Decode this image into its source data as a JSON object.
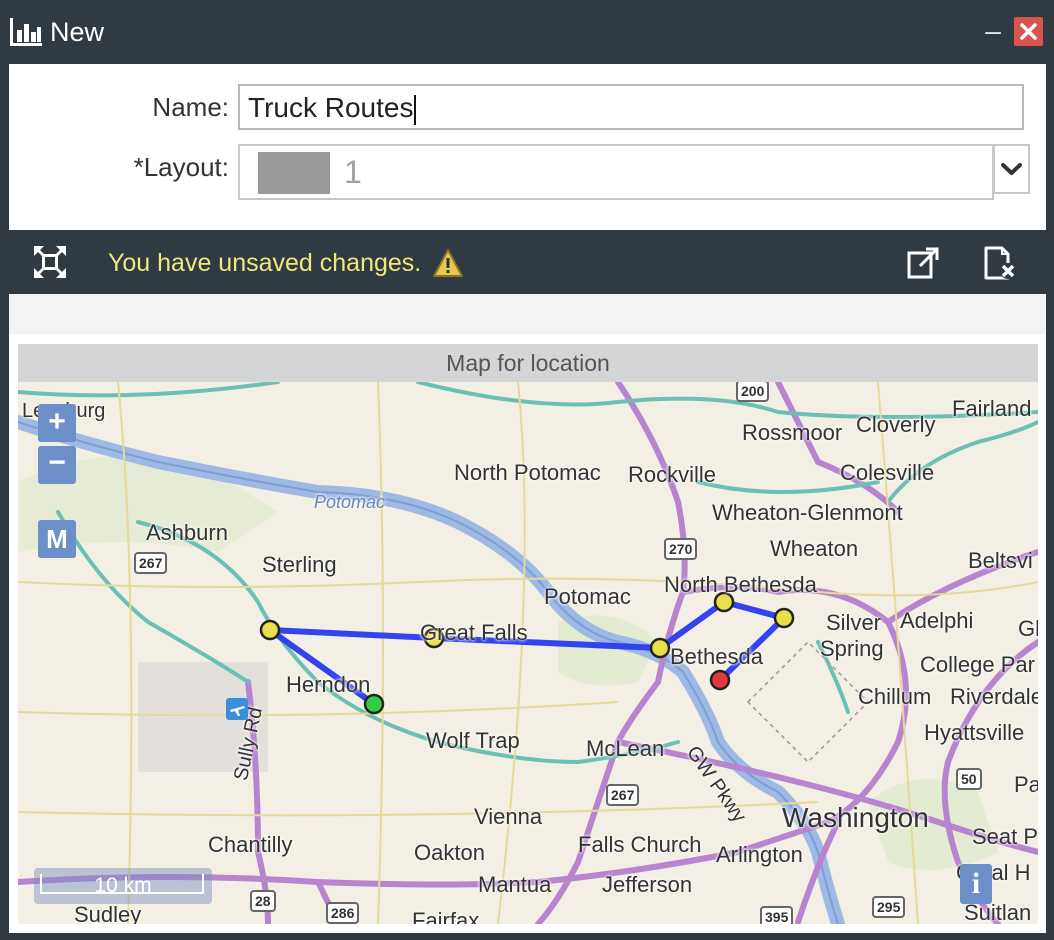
{
  "window": {
    "title": "New"
  },
  "form": {
    "name_label": "Name:",
    "name_value": "Truck Routes",
    "layout_label": "*Layout:",
    "layout_value": "1"
  },
  "toolbar": {
    "unsaved_message": "You have unsaved changes."
  },
  "map": {
    "header": "Map for location",
    "zoom_in": "+",
    "zoom_out": "−",
    "mode_button": "M",
    "info_button": "i",
    "scale": "10 km",
    "labels": {
      "leesburg": "Leesburg",
      "fairland": "Fairland",
      "rossmoor": "Rossmoor",
      "cloverly": "Cloverly",
      "north_potomac": "North Potomac",
      "rockville": "Rockville",
      "colesville": "Colesville",
      "potomac_river": "Potomac",
      "wheaton_glenmont": "Wheaton-Glenmont",
      "ashburn": "Ashburn",
      "wheaton": "Wheaton",
      "beltsville": "Beltsvi",
      "sterling": "Sterling",
      "north_bethesda": "North Bethesda",
      "potomac": "Potomac",
      "silver_spring_1": "Silver",
      "silver_spring_2": "Spring",
      "adelphi": "Adelphi",
      "great_falls": "Great Falls",
      "bethesda": "Bethesda",
      "college_park": "College Par",
      "herndon": "Herndon",
      "chillum": "Chillum",
      "riverdale": "Riverdale",
      "wolf_trap": "Wolf Trap",
      "mclean": "McLean",
      "hyattsville": "Hyattsville",
      "sully_rd": "Sully Rd",
      "gw_pkwy": "GW Pkwy",
      "vienna": "Vienna",
      "washington": "Washington",
      "seat_pleasant": "Seat P",
      "chantilly": "Chantilly",
      "falls_church": "Falls Church",
      "arlington": "Arlington",
      "oakton": "Oakton",
      "coral_hills": "Coral H",
      "mantua": "Mantua",
      "jefferson": "Jefferson",
      "sudley": "Sudley",
      "fairfax": "Fairfax",
      "suitland": "Suitlan",
      "gl": "Gl",
      "pa": "Pa"
    },
    "shields": {
      "r200": "200",
      "r270": "270",
      "r267a": "267",
      "r267b": "267",
      "r50": "50",
      "r28": "28",
      "r286": "286",
      "r295": "295",
      "r395": "395"
    },
    "colors": {
      "route": "#3344ee",
      "stop": "#e8e04a",
      "start": "#33cc44",
      "end": "#e03a3a"
    }
  }
}
